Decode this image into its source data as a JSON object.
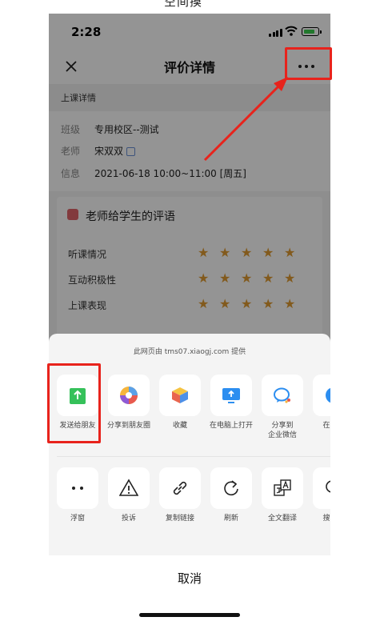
{
  "top_cut_text": "空间摸",
  "status_bar": {
    "time": "2:28"
  },
  "nav": {
    "title": "评价详情"
  },
  "section_header": "上课详情",
  "info": [
    {
      "key": "班级",
      "value": "专用校区--测试"
    },
    {
      "key": "老师",
      "value": "宋双双"
    },
    {
      "key": "信息",
      "value": "2021-06-18 10:00~11:00 [周五]"
    }
  ],
  "card": {
    "title": "老师给学生的评语",
    "criteria": [
      {
        "label": "听课情况",
        "stars": 5
      },
      {
        "label": "互动积极性",
        "stars": 5
      },
      {
        "label": "上课表现",
        "stars": 5
      }
    ]
  },
  "share_sheet": {
    "provided_by": "此网页由 tms07.xiaogj.com 提供",
    "row1": [
      {
        "label": "发送给朋友",
        "icon": "send-to-friend-icon"
      },
      {
        "label": "分享到朋友圈",
        "icon": "moments-icon"
      },
      {
        "label": "收藏",
        "icon": "favorite-cube-icon"
      },
      {
        "label": "在电脑上打开",
        "icon": "open-on-pc-icon"
      },
      {
        "label": "分享到\n企业微信",
        "icon": "wecom-icon"
      },
      {
        "label": "在默认\n中",
        "icon": "browser-icon"
      }
    ],
    "row2": [
      {
        "label": "浮窗",
        "icon": "float-window-icon"
      },
      {
        "label": "投诉",
        "icon": "warning-icon"
      },
      {
        "label": "复制链接",
        "icon": "link-icon"
      },
      {
        "label": "刷新",
        "icon": "refresh-icon"
      },
      {
        "label": "全文翻译",
        "icon": "translate-icon"
      },
      {
        "label": "搜索页",
        "icon": "search-icon"
      }
    ],
    "cancel": "取消"
  },
  "colors": {
    "highlight": "#e8231c",
    "star": "#e09c33",
    "share_green": "#35c15a",
    "overlay": "rgba(0,0,0,0.42)"
  }
}
